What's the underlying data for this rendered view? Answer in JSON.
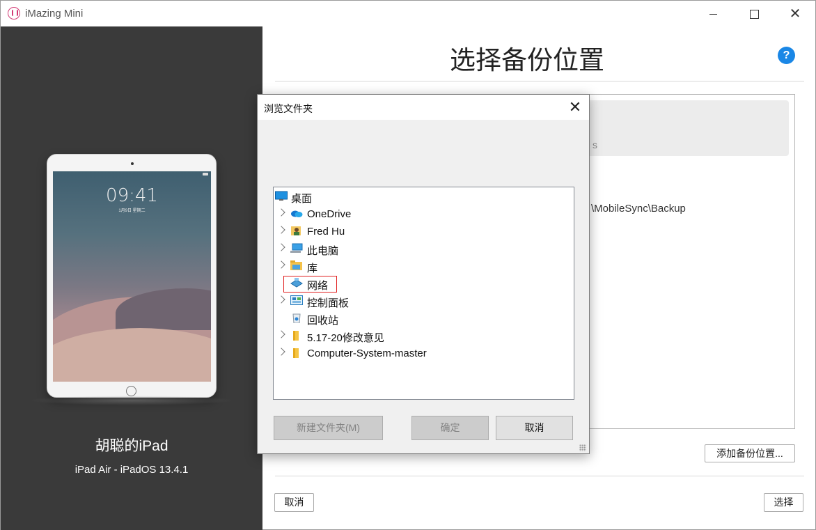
{
  "window": {
    "title": "iMazing Mini",
    "controls": {
      "minimize": "",
      "maximize": "",
      "close": "✕"
    }
  },
  "device": {
    "lock_time": "09:41",
    "lock_date": "1月9日 星期二",
    "name": "胡聪的iPad",
    "model": "iPad Air - iPadOS 13.4.1"
  },
  "main": {
    "title": "选择备份位置",
    "help": "?",
    "selected_location_partial": "s",
    "location_path_partial": "\\MobileSync\\Backup",
    "add_location_label": "添加备份位置...",
    "cancel_label": "取消",
    "choose_label": "选择"
  },
  "dialog": {
    "title": "浏览文件夹",
    "close": "✕",
    "tree": [
      {
        "label": "桌面",
        "icon": "desktop-icon",
        "expandable": false
      },
      {
        "label": "OneDrive",
        "icon": "onedrive-cloud-icon",
        "expandable": true
      },
      {
        "label": "Fred Hu",
        "icon": "user-folder-icon",
        "expandable": true
      },
      {
        "label": "此电脑",
        "icon": "computer-icon",
        "expandable": true
      },
      {
        "label": "库",
        "icon": "library-icon",
        "expandable": true
      },
      {
        "label": "网络",
        "icon": "network-icon",
        "expandable": false,
        "selected": true
      },
      {
        "label": "控制面板",
        "icon": "control-panel-icon",
        "expandable": true
      },
      {
        "label": "回收站",
        "icon": "recycle-bin-icon",
        "expandable": false
      },
      {
        "label": "5.17-20修改意见",
        "icon": "folder-icon",
        "expandable": true
      },
      {
        "label": "Computer-System-master",
        "icon": "folder-icon",
        "expandable": true
      }
    ],
    "new_folder_label": "新建文件夹(M)",
    "ok_label": "确定",
    "cancel_label": "取消"
  }
}
